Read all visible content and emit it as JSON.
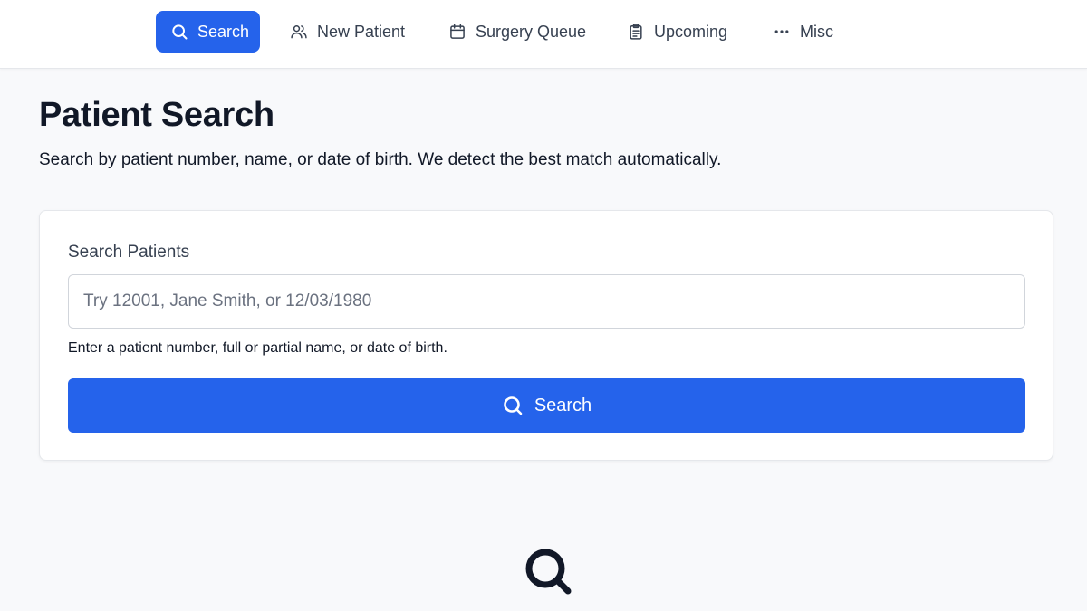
{
  "nav": {
    "items": [
      {
        "label": "Search",
        "icon": "search-icon",
        "active": true
      },
      {
        "label": "New Patient",
        "icon": "users-icon",
        "active": false
      },
      {
        "label": "Surgery Queue",
        "icon": "calendar-icon",
        "active": false
      },
      {
        "label": "Upcoming",
        "icon": "clipboard-icon",
        "active": false
      },
      {
        "label": "Misc",
        "icon": "more-dots-icon",
        "active": false
      }
    ]
  },
  "page": {
    "title": "Patient Search",
    "subtitle": "Search by patient number, name, or date of birth. We detect the best match automatically."
  },
  "search_card": {
    "label": "Search Patients",
    "placeholder": "Try 12001, Jane Smith, or 12/03/1980",
    "value": "",
    "helper": "Enter a patient number, full or partial name, or date of birth.",
    "button_label": "Search",
    "button_icon": "search-icon"
  },
  "empty_state": {
    "icon": "search-icon"
  },
  "colors": {
    "accent": "#2563eb",
    "background": "#f8f9fb",
    "text": "#111827"
  }
}
